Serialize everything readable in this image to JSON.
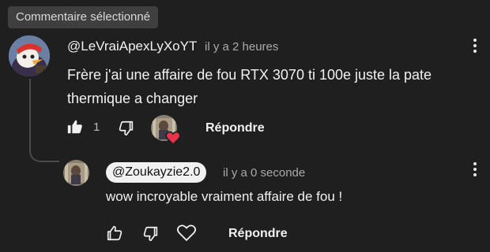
{
  "header": {
    "badge": "Commentaire sélectionné"
  },
  "comment": {
    "author": "@LeVraiApexLyXoYT",
    "time": "il y a 2 heures",
    "text": "Frère j'ai une affaire de fou RTX 3070 ti 100e juste la pate thermique a changer",
    "likes": "1",
    "reply_label": "Répondre"
  },
  "reply": {
    "author": "@Zoukayzie2.0",
    "time": "il y a 0 seconde",
    "text": "wow incroyable vraiment affaire de fou !",
    "reply_label": "Répondre"
  },
  "colors": {
    "background": "#1f1f1f",
    "heart": "#e8334a",
    "pill": "#f1f1f1"
  }
}
